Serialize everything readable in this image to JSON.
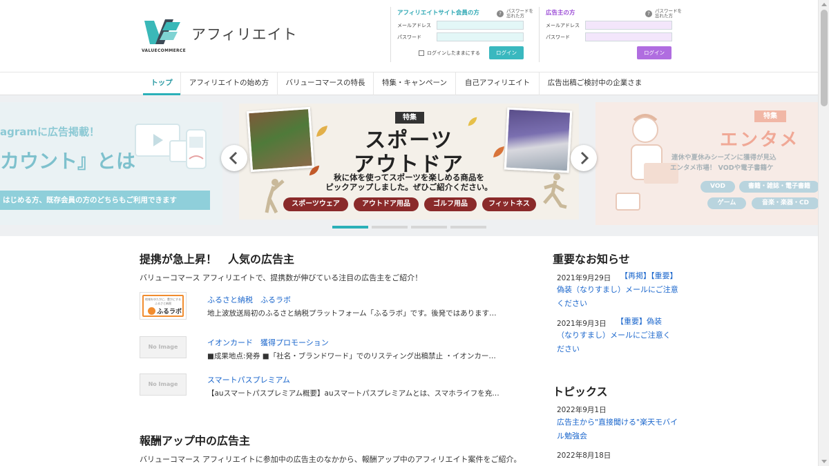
{
  "header": {
    "logo_sub": "VALUECOMMERCE",
    "site_title": "アフィリエイト"
  },
  "affiliate_login": {
    "title": "アフィリエイトサイト会員の方",
    "forgot": "パスワードを忘れた方",
    "email_label": "メールアドレス",
    "password_label": "パスワード",
    "email_value": "",
    "password_value": "",
    "remember": "ログインしたままにする",
    "button": "ログイン"
  },
  "advertiser_login": {
    "title": "広告主の方",
    "forgot": "パスワードを忘れた方",
    "email_label": "メールアドレス",
    "password_label": "パスワード",
    "email_value": "",
    "password_value": "",
    "button": "ログイン"
  },
  "nav": {
    "items": [
      {
        "label": "トップ",
        "active": true
      },
      {
        "label": "アフィリエイトの始め方"
      },
      {
        "label": "バリューコマースの特長"
      },
      {
        "label": "特集・キャンペーン"
      },
      {
        "label": "自己アフィリエイト"
      },
      {
        "label": "広告出稿ご検討中の企業さま"
      }
    ]
  },
  "banner": {
    "left": {
      "line1": "agramに広告掲載！",
      "line2": "カウント』とは",
      "line3": "はじめる方、既存会員の方のどちらもご利用できます"
    },
    "main": {
      "tag": "特集",
      "title1": "スポーツ",
      "title2": "アウトドア",
      "desc1": "秋に体を使ってスポーツを楽しめる商品を",
      "desc2": "ピックアップしました。ぜひご紹介ください。",
      "chips": [
        "スポーツウェア",
        "アウトドア用品",
        "ゴルフ用品",
        "フィットネス"
      ]
    },
    "right": {
      "tag": "特集",
      "title": "エンタメ",
      "desc1": "連休や夏休みシーズンに獲得が見込",
      "desc2": "エンタメ市場！ VODや電子書籍ケ",
      "chips": [
        "VOD",
        "書籍・雑誌・電子書籍",
        "ゲーム",
        "音楽・楽器・CD"
      ]
    },
    "prev_icon": "chevron-left-icon",
    "next_icon": "chevron-right-icon",
    "slide_count": 4,
    "active_slide": 1
  },
  "popular": {
    "heading": "提携が急上昇！　人気の広告主",
    "intro": "バリューコマース アフィリエイトで、提携数が伸びている注目の広告主をご紹介！",
    "items": [
      {
        "name": "ふるさと納税　ふるラボ",
        "desc": "地上波放送局初のふるさと納税プラットフォーム「ふるラボ」です。後発ではあります…",
        "logo_text1": "地域をゆたかに、豊かにする",
        "logo_text2": "ふるさと納税",
        "logo_brand": "ふるラボ"
      },
      {
        "name": "イオンカード　獲得プロモーション",
        "desc": "■成果地点:発券 ■「社名・ブランドワード」でのリスティング出稿禁止 ・イオンカー…",
        "thumb": "No Image"
      },
      {
        "name": "スマートパスプレミアム",
        "desc": "【auスマートパスプレミアム概要】auスマートパスプレミアムとは、スマホライフを充…",
        "thumb": "No Image"
      }
    ]
  },
  "reward_up": {
    "heading": "報酬アップ中の広告主",
    "intro": "バリューコマース アフィリエイトに参加中の広告主のなかから、報酬アップ中のアフィリエイト案件をご紹介。"
  },
  "notices": {
    "heading": "重要なお知らせ",
    "items": [
      {
        "date": "2021年9月29日",
        "text": "【再掲】【重要】偽装（なりすまし）メールにご注意ください"
      },
      {
        "date": "2021年9月3日",
        "text": "【重要】偽装（なりすまし）メールにご注意ください"
      }
    ]
  },
  "topics": {
    "heading": "トピックス",
    "items": [
      {
        "date": "2022年9月1日",
        "text": "広告主から\"直接聞ける\"楽天モバイル勉強会"
      },
      {
        "date": "2022年8月18日",
        "text": ""
      }
    ]
  },
  "colors": {
    "accent_teal": "#2ab0b8",
    "accent_purple": "#b06de0",
    "link": "#1a66cc",
    "chip": "#8a2a2a"
  }
}
